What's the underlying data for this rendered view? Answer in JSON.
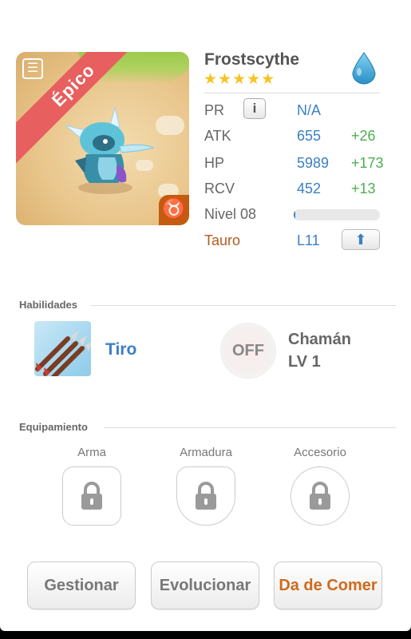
{
  "monster": {
    "name": "Frostscythe",
    "stars": "★★★★★",
    "rarity": "Épico",
    "zodiac_symbol": "♉",
    "element": "water"
  },
  "stats": {
    "pr": {
      "label": "PR",
      "value": "N/A",
      "info_icon": "i"
    },
    "atk": {
      "label": "ATK",
      "value": "655",
      "bonus": "+26"
    },
    "hp": {
      "label": "HP",
      "value": "5989",
      "bonus": "+173"
    },
    "rcv": {
      "label": "RCV",
      "value": "452",
      "bonus": "+13"
    },
    "level": {
      "label": "Nivel 08",
      "xp_fraction": 0.02
    },
    "zodiac": {
      "label": "Tauro",
      "value": "L11"
    }
  },
  "abilities": {
    "title": "Habilidades",
    "skill1": {
      "name": "Tiro"
    },
    "skill2": {
      "state": "OFF",
      "name": "Chamán",
      "level": "LV 1"
    }
  },
  "equipment": {
    "title": "Equipamiento",
    "slots": [
      {
        "label": "Arma"
      },
      {
        "label": "Armadura"
      },
      {
        "label": "Accesorio"
      }
    ]
  },
  "actions": {
    "manage": "Gestionar",
    "evolve": "Evolucionar",
    "feed": "Da de Comer"
  },
  "colors": {
    "accent_blue": "#3b7fc4",
    "bonus_green": "#4caf50",
    "epic_red": "#e85f5f",
    "zodiac_orange": "#c55a11"
  }
}
